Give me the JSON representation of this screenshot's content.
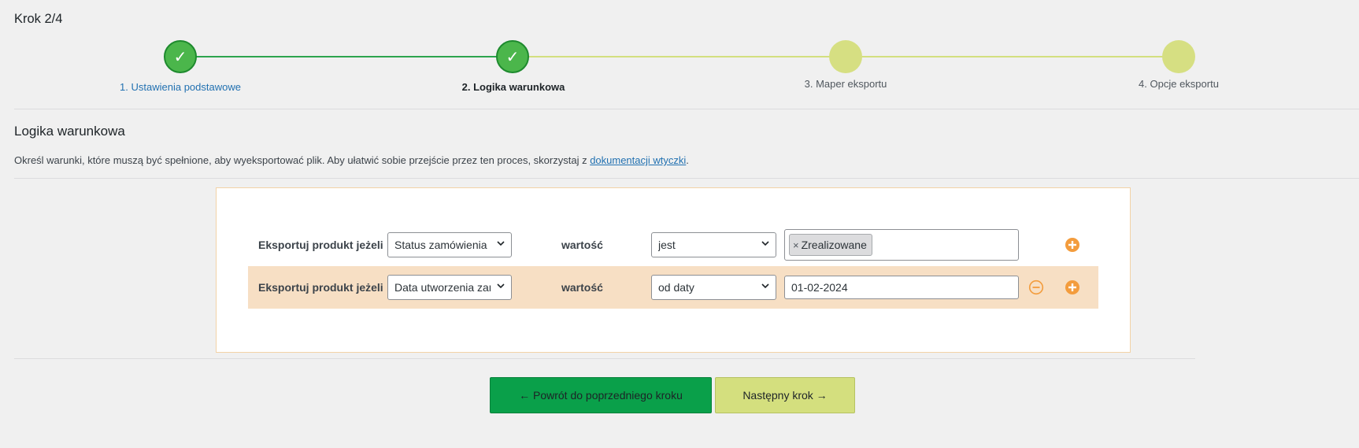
{
  "page": {
    "step_heading": "Krok 2/4"
  },
  "stepper": {
    "steps": [
      {
        "label": "1. Ustawienia podstawowe",
        "status": "done"
      },
      {
        "label": "2. Logika warunkowa",
        "status": "current"
      },
      {
        "label": "3. Maper eksportu",
        "status": "todo"
      },
      {
        "label": "4. Opcje eksportu",
        "status": "todo"
      }
    ],
    "check_glyph": "✓",
    "colors": {
      "done": "#4bb64b",
      "done_border": "#1e8a2e",
      "todo": "#d6df82",
      "line_done": "#2da44e",
      "line_todo": "#d3df7f"
    }
  },
  "section": {
    "title": "Logika warunkowa",
    "description_before": "Określ warunki, które muszą być spełnione, aby wyeksportować plik. Aby ułatwić sobie przejście przez ten proces, skorzystaj z ",
    "description_link": "dokumentacji wtyczki",
    "description_after": "."
  },
  "rules": [
    {
      "label": "Eksportuj produkt jeżeli",
      "field": "Status zamówienia",
      "value_label": "wartość",
      "operator": "jest",
      "value_tags": [
        "Zrealizowane"
      ],
      "tag_remove_glyph": "×",
      "highlighted": false,
      "buttons": [
        "plus-circle-icon"
      ]
    },
    {
      "label": "Eksportuj produkt jeżeli",
      "field": "Data utworzenia zamówienia",
      "value_label": "wartość",
      "operator": "od daty",
      "value_text": "01-02-2024",
      "highlighted": true,
      "buttons": [
        "minus-circle-icon",
        "plus-circle-icon"
      ]
    }
  ],
  "footer": {
    "back_label": "← Powrót do poprzedniego kroku",
    "next_label": "Następny krok →"
  },
  "colors": {
    "accent_orange": "#f39c3d",
    "highlight_row": "#f7dfc4",
    "back_button": "#0aa04a",
    "next_button": "#d4df7e",
    "link": "#2271b1"
  }
}
